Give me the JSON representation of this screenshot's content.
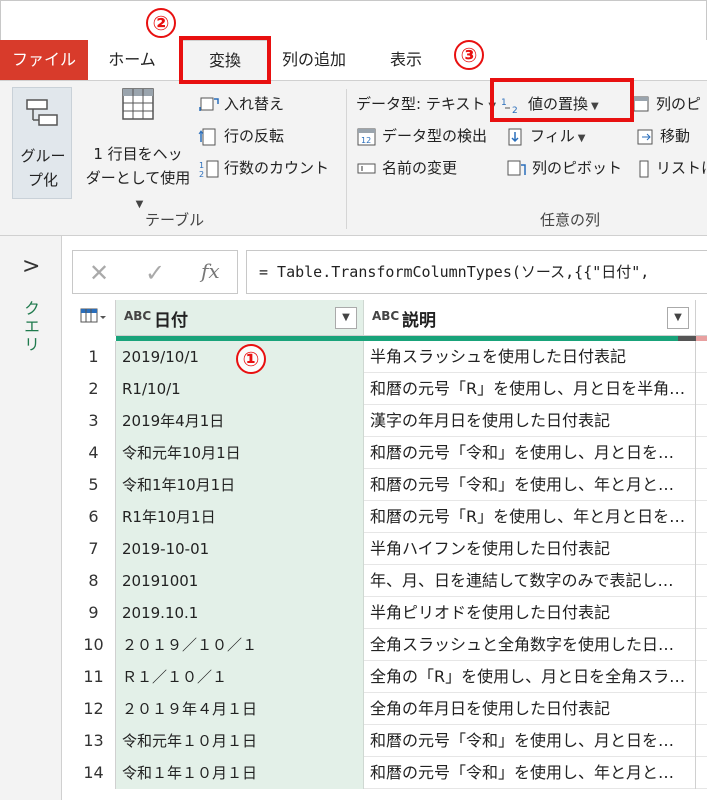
{
  "tabs": {
    "file": "ファイル",
    "home": "ホーム",
    "transform": "変換",
    "add_column": "列の追加",
    "view": "表示"
  },
  "ribbon": {
    "table_group": {
      "label": "テーブル",
      "group_by": [
        "グルー",
        "プ化"
      ],
      "use_first_row": [
        "1 行目をヘッ",
        "ダーとして使用"
      ],
      "transpose": "入れ替え",
      "reverse_rows": "行の反転",
      "count_rows": "行数のカウント"
    },
    "any_column_group": {
      "label": "任意の列",
      "data_type": "データ型: テキスト",
      "detect_type": "データ型の検出",
      "rename": "名前の変更",
      "replace_values": "値の置換",
      "fill": "フィル",
      "pivot": "列のピボット",
      "unpivot": "列のピ",
      "move": "移動",
      "to_list": "リストに"
    }
  },
  "sidebar": {
    "queries_label": "クエリ"
  },
  "formula": {
    "text": "= Table.TransformColumnTypes(ソース,{{\"日付\", "
  },
  "grid": {
    "columns": [
      {
        "type": "ABC",
        "name": "日付"
      },
      {
        "type": "ABC",
        "name": "説明"
      }
    ],
    "rows": [
      {
        "n": "1",
        "date": "2019/10/1",
        "desc": "半角スラッシュを使用した日付表記"
      },
      {
        "n": "2",
        "date": "R1/10/1",
        "desc": "和暦の元号「R」を使用し、月と日を半角…"
      },
      {
        "n": "3",
        "date": "2019年4月1日",
        "desc": "漢字の年月日を使用した日付表記"
      },
      {
        "n": "4",
        "date": "令和元年10月1日",
        "desc": "和暦の元号「令和」を使用し、月と日を…"
      },
      {
        "n": "5",
        "date": "令和1年10月1日",
        "desc": "和暦の元号「令和」を使用し、年と月と…"
      },
      {
        "n": "6",
        "date": "R1年10月1日",
        "desc": "和暦の元号「R」を使用し、年と月と日を…"
      },
      {
        "n": "7",
        "date": "2019-10-01",
        "desc": "半角ハイフンを使用した日付表記"
      },
      {
        "n": "8",
        "date": "20191001",
        "desc": "年、月、日を連結して数字のみで表記し…"
      },
      {
        "n": "9",
        "date": "2019.10.1",
        "desc": "半角ピリオドを使用した日付表記"
      },
      {
        "n": "10",
        "date": "２０１９／１０／１",
        "desc": "全角スラッシュと全角数字を使用した日…"
      },
      {
        "n": "11",
        "date": "Ｒ１／１０／１",
        "desc": "全角の「R」を使用し、月と日を全角スラ…"
      },
      {
        "n": "12",
        "date": "２０１９年４月１日",
        "desc": "全角の年月日を使用した日付表記"
      },
      {
        "n": "13",
        "date": "令和元年１０月１日",
        "desc": "和暦の元号「令和」を使用し、月と日を…"
      },
      {
        "n": "14",
        "date": "令和１年１０月１日",
        "desc": "和暦の元号「令和」を使用し、年と月と…"
      }
    ]
  },
  "annotations": {
    "one": "①",
    "two": "②",
    "three": "③"
  },
  "colors": {
    "accent_red": "#e81010",
    "file_tab": "#d83b2b",
    "selected_column": "#e3f0e8",
    "quality_green": "#19a37a",
    "query_label": "#1f7a4d"
  }
}
